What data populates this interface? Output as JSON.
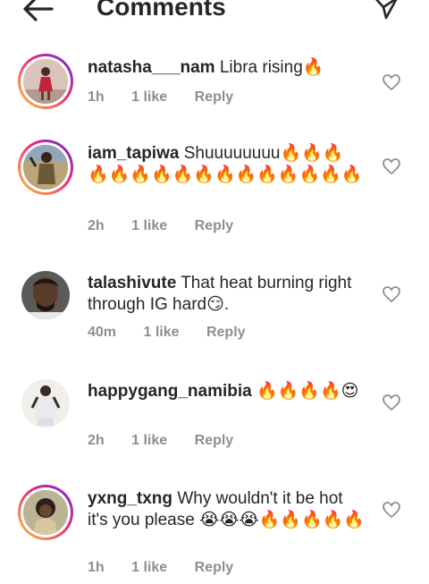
{
  "header": {
    "title": "Comments",
    "back_icon": "arrow-left-icon",
    "send_icon": "send-paper-plane-icon"
  },
  "comments": [
    {
      "username": "natasha___nam",
      "text": "Libra rising🔥",
      "time": "1h",
      "likes": "1 like",
      "reply": "Reply"
    },
    {
      "username": "iam_tapiwa",
      "text": "Shuuuuuuuu🔥🔥🔥🔥🔥🔥🔥🔥🔥🔥🔥🔥🔥🔥🔥🔥",
      "time": "2h",
      "likes": "1 like",
      "reply": "Reply"
    },
    {
      "username": "talashivute",
      "text": "That heat burning right through IG hard😏.",
      "time": "40m",
      "likes": "1 like",
      "reply": "Reply"
    },
    {
      "username": "happygang_namibia",
      "text": "🔥🔥🔥🔥😍",
      "time": "2h",
      "likes": "1 like",
      "reply": "Reply"
    },
    {
      "username": "yxng_txng",
      "text": "Why wouldn't it be hot it's you please 😭😭😭🔥🔥🔥🔥🔥",
      "time": "1h",
      "likes": "1 like",
      "reply": "Reply"
    }
  ],
  "colors": {
    "text": "#262626",
    "meta": "#8e8e8e",
    "ring_start": "#f9ce34",
    "ring_mid": "#ee2a7b",
    "ring_end": "#6228d7"
  }
}
